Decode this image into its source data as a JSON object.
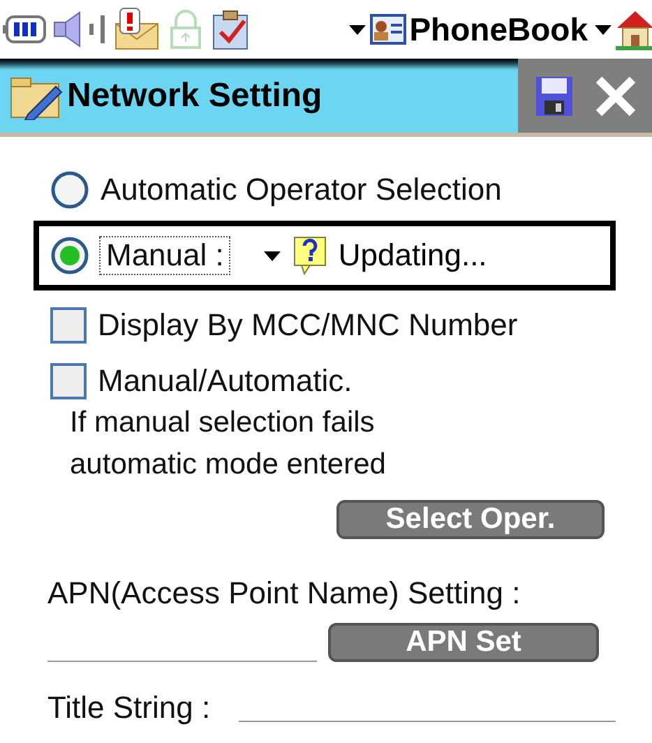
{
  "status_bar": {
    "app_menu": "PhoneBook"
  },
  "window": {
    "title": "Network Setting"
  },
  "operator_selection": [
    {
      "label": "Automatic Operator Selection",
      "selected": false,
      "focused": false
    },
    {
      "label": "Manual :",
      "selected": true,
      "focused": true,
      "value": "Updating..."
    }
  ],
  "options": [
    {
      "label": "Display By MCC/MNC Number",
      "checked": false
    },
    {
      "label": "Manual/Automatic.",
      "note_lines": [
        "If manual selection fails",
        "automatic mode entered"
      ],
      "checked": false
    }
  ],
  "select_operator_button": "Select Oper.",
  "apn": {
    "label": "APN(Access Point Name) Setting :",
    "button": "APN Set"
  },
  "title_string": {
    "label": "Title String :"
  }
}
